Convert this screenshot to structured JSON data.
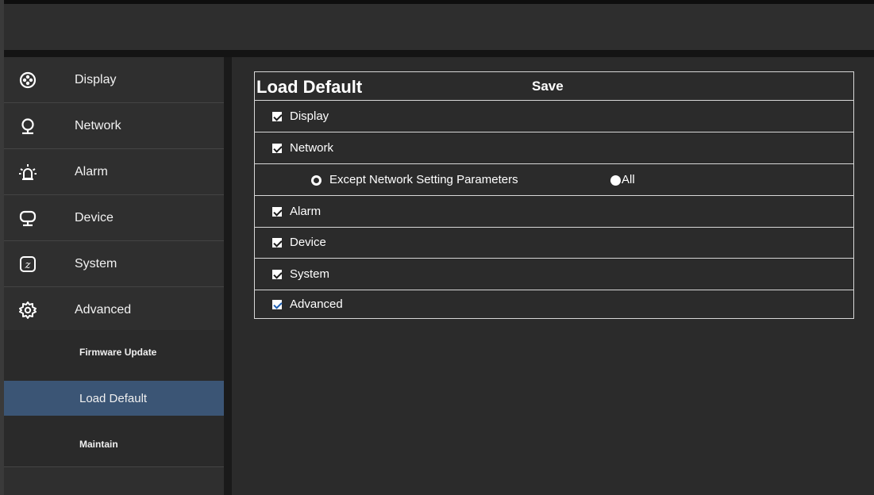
{
  "sidebar": {
    "items": [
      {
        "label": "Display",
        "icon": "display-icon"
      },
      {
        "label": "Network",
        "icon": "network-icon"
      },
      {
        "label": "Alarm",
        "icon": "alarm-icon"
      },
      {
        "label": "Device",
        "icon": "device-icon"
      },
      {
        "label": "System",
        "icon": "system-icon"
      },
      {
        "label": "Advanced",
        "icon": "gear-icon"
      }
    ],
    "subitems": [
      {
        "label": "Firmware Update"
      },
      {
        "label": "Load Default",
        "active": true
      },
      {
        "label": "Maintain"
      }
    ]
  },
  "panel": {
    "title": "Load Default",
    "save_label": "Save",
    "rows": [
      {
        "label": "Display",
        "checked": true
      },
      {
        "label": "Network",
        "checked": true
      },
      {
        "label": "Alarm",
        "checked": true
      },
      {
        "label": "Device",
        "checked": true
      },
      {
        "label": "System",
        "checked": true
      },
      {
        "label": "Advanced",
        "checked": true
      }
    ],
    "network_options": [
      {
        "label": "Except Network Setting Parameters",
        "selected": true
      },
      {
        "label": "All",
        "selected": false
      }
    ]
  },
  "colors": {
    "active_item": "#3b5575",
    "background": "#2b2b2b",
    "sidebar": "#2f2f2f"
  }
}
